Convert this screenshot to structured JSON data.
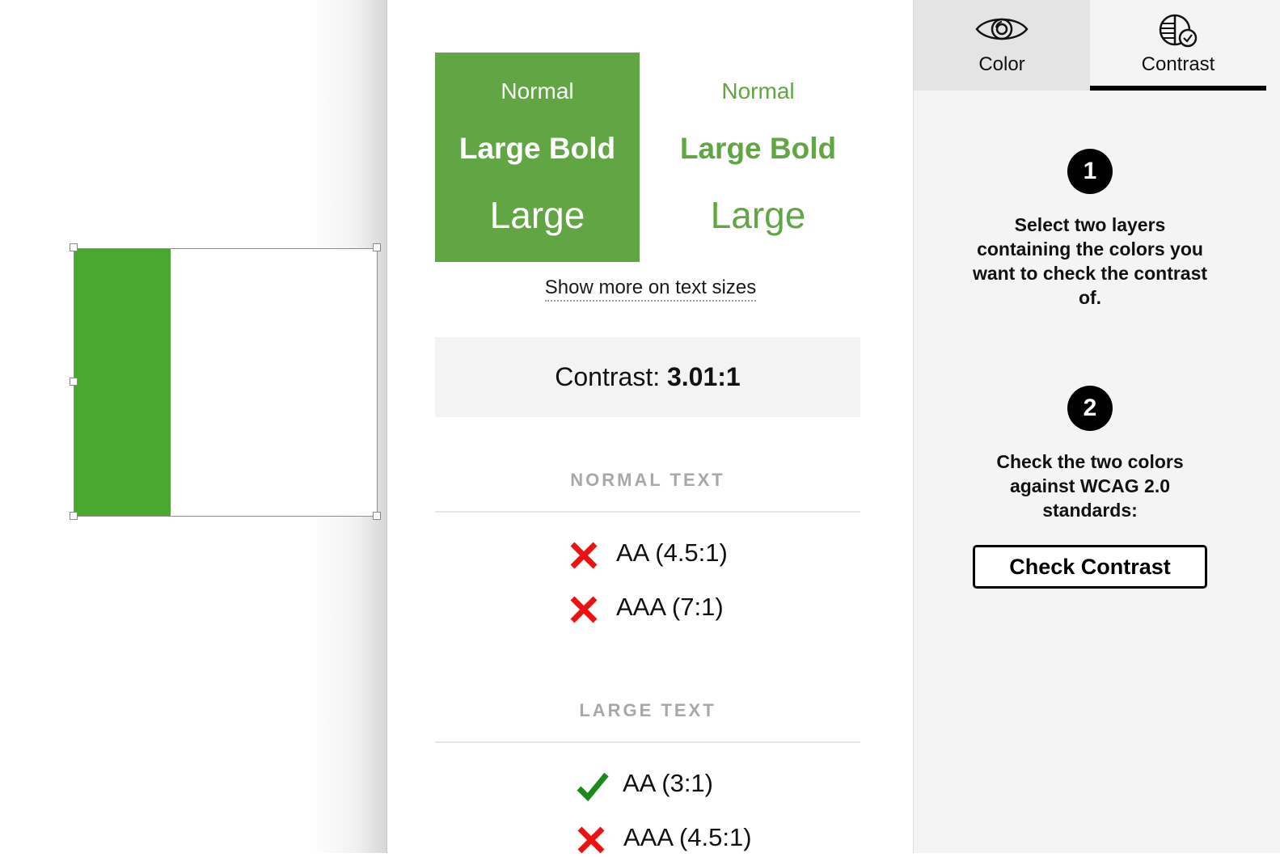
{
  "colors": {
    "canvas_green": "#4aa72f",
    "preview_green": "#62a544",
    "fail_red": "#ee1111",
    "pass_green": "#1a8a1a"
  },
  "preview": {
    "filled": {
      "normal": "Normal",
      "large_bold": "Large Bold",
      "large": "Large"
    },
    "plain": {
      "normal": "Normal",
      "large_bold": "Large Bold",
      "large": "Large"
    }
  },
  "show_more_link": "Show more on text sizes",
  "contrast": {
    "label": "Contrast:",
    "value": "3.01:1"
  },
  "sections": [
    {
      "heading": "NORMAL TEXT",
      "results": [
        {
          "label": "AA (4.5:1)",
          "status": "fail",
          "icon": "fail-x-icon"
        },
        {
          "label": "AAA (7:1)",
          "status": "fail",
          "icon": "fail-x-icon"
        }
      ]
    },
    {
      "heading": "LARGE TEXT",
      "results": [
        {
          "label": "AA (3:1)",
          "status": "pass",
          "icon": "pass-check-icon"
        },
        {
          "label": "AAA (4.5:1)",
          "status": "fail",
          "icon": "fail-x-icon"
        }
      ]
    }
  ],
  "tabs": [
    {
      "label": "Color",
      "icon": "eye-icon",
      "active": false
    },
    {
      "label": "Contrast",
      "icon": "contrast-icon",
      "active": true
    }
  ],
  "steps": [
    {
      "number": "1",
      "text": "Select two layers containing the colors you want to check the contrast of."
    },
    {
      "number": "2",
      "text": "Check the two colors against WCAG 2.0 standards:"
    }
  ],
  "check_button": "Check Contrast"
}
